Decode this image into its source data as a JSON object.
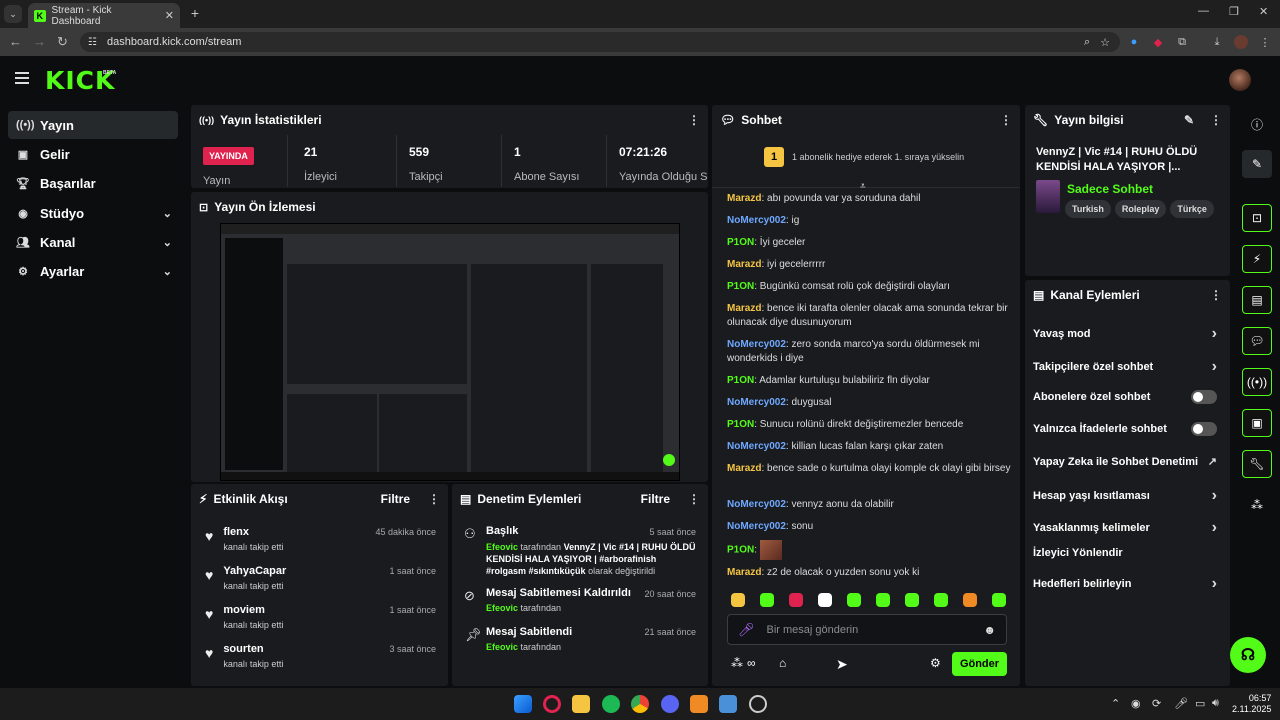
{
  "browser": {
    "tab_title": "Stream - Kick Dashboard",
    "url": "dashboard.kick.com/stream"
  },
  "header": {
    "logo": "KICK",
    "beta": "BETA"
  },
  "sidebar": {
    "items": [
      {
        "label": "Yayın",
        "icon": "broadcast-icon",
        "active": true,
        "expandable": false
      },
      {
        "label": "Gelir",
        "icon": "revenue-icon",
        "active": false,
        "expandable": false
      },
      {
        "label": "Başarılar",
        "icon": "trophy-icon",
        "active": false,
        "expandable": false
      },
      {
        "label": "Stüdyo",
        "icon": "studio-icon",
        "active": false,
        "expandable": true
      },
      {
        "label": "Kanal",
        "icon": "channel-icon",
        "active": false,
        "expandable": true
      },
      {
        "label": "Ayarlar",
        "icon": "gear-icon",
        "active": false,
        "expandable": true
      }
    ]
  },
  "stats": {
    "title": "Yayın İstatistikleri",
    "live_badge": "YAYINDA",
    "items": [
      {
        "label": "Yayın",
        "value": ""
      },
      {
        "label": "İzleyici",
        "value": "21"
      },
      {
        "label": "Takipçi",
        "value": "559"
      },
      {
        "label": "Abone Sayısı",
        "value": "1"
      },
      {
        "label": "Yayında Olduğu Süre",
        "value": "07:21:26"
      }
    ]
  },
  "preview": {
    "title": "Yayın Ön İzlemesi"
  },
  "activity": {
    "title": "Etkinlik Akışı",
    "filter": "Filtre",
    "items": [
      {
        "name": "flenx",
        "sub": "kanalı takip etti",
        "time": "45 dakika önce"
      },
      {
        "name": "YahyaCapar",
        "sub": "kanalı takip etti",
        "time": "1 saat önce"
      },
      {
        "name": "moviem",
        "sub": "kanalı takip etti",
        "time": "1 saat önce"
      },
      {
        "name": "sourten",
        "sub": "kanalı takip etti",
        "time": "3 saat önce"
      }
    ]
  },
  "moderation": {
    "title": "Denetim Eylemleri",
    "filter": "Filtre",
    "items": [
      {
        "title": "Başlık",
        "time": "5 saat önce",
        "user": "Efeovic",
        "by": "tarafından",
        "detail": "VennyZ | Vic #14 | RUHU ÖLDÜ KENDİSİ HALA YAŞIYOR | #arborafinish #rolgasm #sıkıntıküçük",
        "suffix": "olarak değiştirildi"
      },
      {
        "title": "Mesaj Sabitlemesi Kaldırıldı",
        "time": "20 saat önce",
        "user": "Efeovic",
        "by": "tarafından"
      },
      {
        "title": "Mesaj Sabitlendi",
        "time": "21 saat önce",
        "user": "Efeovic",
        "by": "tarafından"
      }
    ]
  },
  "chat": {
    "title": "Sohbet",
    "banner": "1 abonelik hediye ederek 1. sıraya yükselin",
    "banner_rank": "1",
    "messages": [
      {
        "user": "Marazd",
        "color": "u1",
        "text": "abı povunda var ya soruduna dahil"
      },
      {
        "user": "NoMercy002",
        "color": "u2",
        "text": "ig"
      },
      {
        "user": "P1ON",
        "color": "u3",
        "text": "İyi geceler"
      },
      {
        "user": "Marazd",
        "color": "u1",
        "text": "iyi gecelerrrrr"
      },
      {
        "user": "P1ON",
        "color": "u3",
        "text": "Bugünkü comsat rolü çok değiştirdi olayları"
      },
      {
        "user": "Marazd",
        "color": "u1",
        "text": "bence iki tarafta olenler olacak ama sonunda tekrar bir olunacak diye dusunuyorum"
      },
      {
        "user": "NoMercy002",
        "color": "u2",
        "text": "zero sonda marco'ya sordu öldürmesek mi wonderkids i diye"
      },
      {
        "user": "P1ON",
        "color": "u3",
        "text": "Adamlar kurtuluşu bulabiliriz fln diyolar"
      },
      {
        "user": "NoMercy002",
        "color": "u2",
        "text": "duygusal"
      },
      {
        "user": "P1ON",
        "color": "u3",
        "text": "Sunucu rolünü direkt değiştiremezler bencede"
      },
      {
        "user": "NoMercy002",
        "color": "u2",
        "text": "killian lucas falan karşı çıkar zaten"
      },
      {
        "user": "Marazd",
        "color": "u1",
        "text": "bence sade o kurtulma olayi komple ck olayi gibi birsey"
      },
      {
        "user": "NoMercy002",
        "color": "u2",
        "text": "vennyz aonu da olabilir"
      },
      {
        "user": "NoMercy002",
        "color": "u2",
        "text": "sonu"
      },
      {
        "user": "P1ON",
        "color": "u3",
        "text": ""
      },
      {
        "user": "Marazd",
        "color": "u1",
        "text": "z2 de olacak o yuzden sonu yok ki"
      }
    ],
    "input_placeholder": "Bir mesaj gönderin",
    "send": "Gönder"
  },
  "stream_info": {
    "title": "Yayın bilgisi",
    "stream_title": "VennyZ | Vic #14 | RUHU ÖLDÜ KENDİSİ HALA YAŞIYOR |...",
    "category": "Sadece Sohbet",
    "tags": [
      "Turkish",
      "Roleplay",
      "Türkçe"
    ]
  },
  "channel_actions": {
    "title": "Kanal Eylemleri",
    "items": [
      {
        "label": "Yavaş mod",
        "kind": "chevron"
      },
      {
        "label": "Takipçilere özel sohbet",
        "kind": "chevron"
      },
      {
        "label": "Abonelere özel sohbet",
        "kind": "toggle"
      },
      {
        "label": "Yalnızca İfadelerle sohbet",
        "kind": "toggle"
      },
      {
        "label": "Yapay Zeka ile Sohbet Denetimi",
        "kind": "external"
      },
      {
        "label": "Hesap yaşı kısıtlaması",
        "kind": "chevron"
      },
      {
        "label": "Yasaklanmış kelimeler",
        "kind": "chevron"
      },
      {
        "label": "İzleyici Yönlendir",
        "kind": "none"
      },
      {
        "label": "Hedefleri belirleyin",
        "kind": "chevron"
      }
    ]
  },
  "taskbar": {
    "time": "06:57",
    "date": "2.11.2025"
  },
  "colors": {
    "accent": "#53fc18",
    "live": "#e0224f",
    "panel": "#191b1f",
    "bg": "#0b0d0e"
  }
}
